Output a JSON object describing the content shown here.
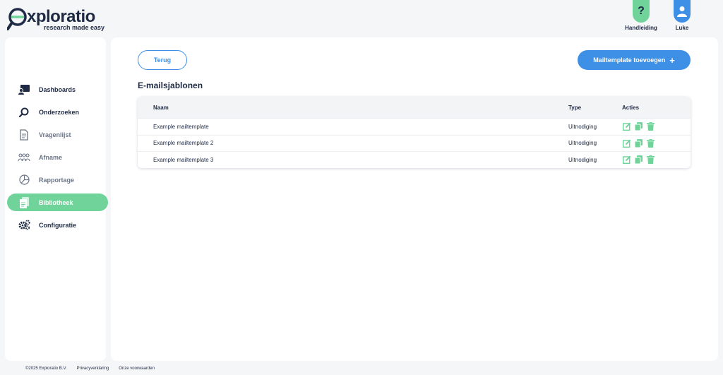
{
  "brand": {
    "name": "xploratio",
    "tagline": "research made easy"
  },
  "header": {
    "help_label": "Handleiding",
    "help_glyph": "?",
    "user_label": "Luke"
  },
  "sidebar": {
    "items": [
      {
        "label": "Dashboards",
        "icon": "dashboard-icon",
        "state": "default"
      },
      {
        "label": "Onderzoeken",
        "icon": "search-icon",
        "state": "default"
      },
      {
        "label": "Vragenlijst",
        "icon": "document-icon",
        "state": "muted"
      },
      {
        "label": "Afname",
        "icon": "people-icon",
        "state": "muted"
      },
      {
        "label": "Rapportage",
        "icon": "pie-chart-icon",
        "state": "muted"
      },
      {
        "label": "Bibliotheek",
        "icon": "library-icon",
        "state": "active"
      },
      {
        "label": "Configuratie",
        "icon": "gears-icon",
        "state": "default"
      }
    ]
  },
  "main": {
    "back_label": "Terug",
    "add_label": "Mailtemplate toevoegen",
    "add_glyph": "+",
    "title": "E-mailsjablonen",
    "table": {
      "headers": {
        "name": "Naam",
        "type": "Type",
        "actions": "Acties"
      },
      "rows": [
        {
          "name": "Example mailtemplate",
          "type": "Uitnodiging"
        },
        {
          "name": "Example mailtemplate 2",
          "type": "Uitnodiging"
        },
        {
          "name": "Example mailtemplate 3",
          "type": "Uitnodiging"
        }
      ]
    }
  },
  "footer": {
    "copyright": "©2025 Exploratio B.V.",
    "privacy": "Privacyverklaring",
    "terms": "Onze voorwaarden"
  },
  "colors": {
    "primary": "#3e8fe6",
    "accent": "#6fd39a",
    "text": "#1f2a44",
    "action_icons": "#6fd39a"
  }
}
